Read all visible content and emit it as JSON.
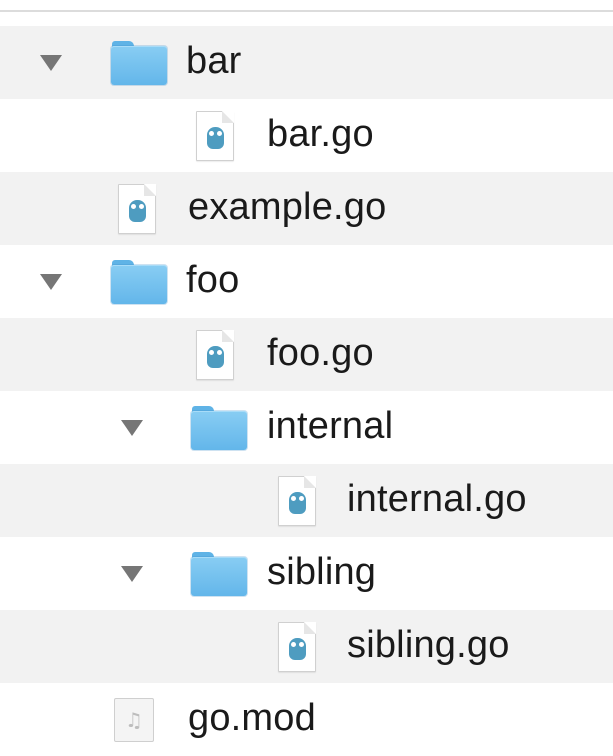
{
  "tree": {
    "items": [
      {
        "name": "bar",
        "kind": "folder",
        "expanded": true
      },
      {
        "name": "bar.go",
        "kind": "go-file"
      },
      {
        "name": "example.go",
        "kind": "go-file"
      },
      {
        "name": "foo",
        "kind": "folder",
        "expanded": true
      },
      {
        "name": "foo.go",
        "kind": "go-file"
      },
      {
        "name": "internal",
        "kind": "folder",
        "expanded": true
      },
      {
        "name": "internal.go",
        "kind": "go-file"
      },
      {
        "name": "sibling",
        "kind": "folder",
        "expanded": true
      },
      {
        "name": "sibling.go",
        "kind": "go-file"
      },
      {
        "name": "go.mod",
        "kind": "mod-file"
      }
    ]
  },
  "icons": {
    "disclosure": "disclosure-triangle-down-icon",
    "folder": "folder-icon",
    "go_file": "go-gopher-file-icon",
    "mod_file": "music-note-file-icon",
    "mod_glyph": "♫"
  },
  "colors": {
    "folder": "#6ab9ec",
    "gopher": "#4e9cc0",
    "row_stripe": "#f2f2f2",
    "disclosure": "#767676"
  }
}
